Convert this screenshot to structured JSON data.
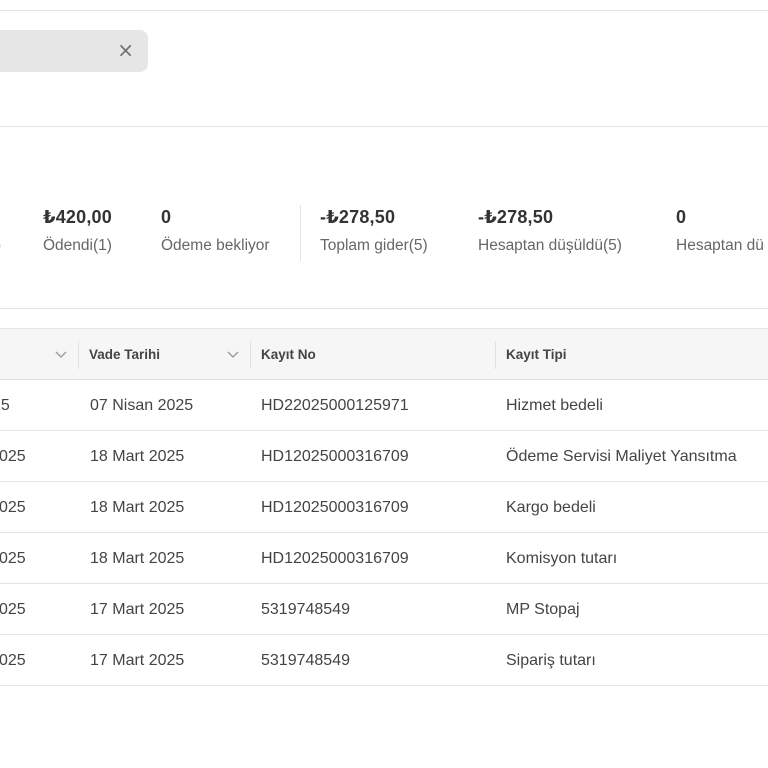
{
  "filter_chip": {
    "close_symbol": "×"
  },
  "summary": [
    {
      "value": "",
      "label": ")"
    },
    {
      "value": "₺420,00",
      "label": "Ödendi(1)"
    },
    {
      "value": "0",
      "label": "Ödeme bekliyor"
    },
    {
      "value": "-₺278,50",
      "label": "Toplam gider(5)"
    },
    {
      "value": "-₺278,50",
      "label": "Hesaptan düşüldü(5)"
    },
    {
      "value": "0",
      "label": "Hesaptan dü"
    }
  ],
  "table": {
    "columns": [
      "Vade Tarihi",
      "Kayıt No",
      "Kayıt Tipi"
    ],
    "rows": [
      {
        "partial_date": "25",
        "due_date": "07 Nisan 2025",
        "record_no": "HD22025000125971",
        "record_type": "Hizmet bedeli"
      },
      {
        "partial_date": "025",
        "due_date": "18 Mart 2025",
        "record_no": "HD12025000316709",
        "record_type": "Ödeme Servisi Maliyet Yansıtma"
      },
      {
        "partial_date": "025",
        "due_date": "18 Mart 2025",
        "record_no": "HD12025000316709",
        "record_type": "Kargo bedeli"
      },
      {
        "partial_date": "025",
        "due_date": "18 Mart 2025",
        "record_no": "HD12025000316709",
        "record_type": "Komisyon tutarı"
      },
      {
        "partial_date": "025",
        "due_date": "17 Mart 2025",
        "record_no": "5319748549",
        "record_type": "MP Stopaj"
      },
      {
        "partial_date": "025",
        "due_date": "17 Mart 2025",
        "record_no": "5319748549",
        "record_type": "Sipariş tutarı"
      }
    ]
  },
  "colors": {
    "header_bg": "#f6f6f6",
    "chip_bg": "#e6e6e6",
    "border": "#e3e3e3"
  }
}
